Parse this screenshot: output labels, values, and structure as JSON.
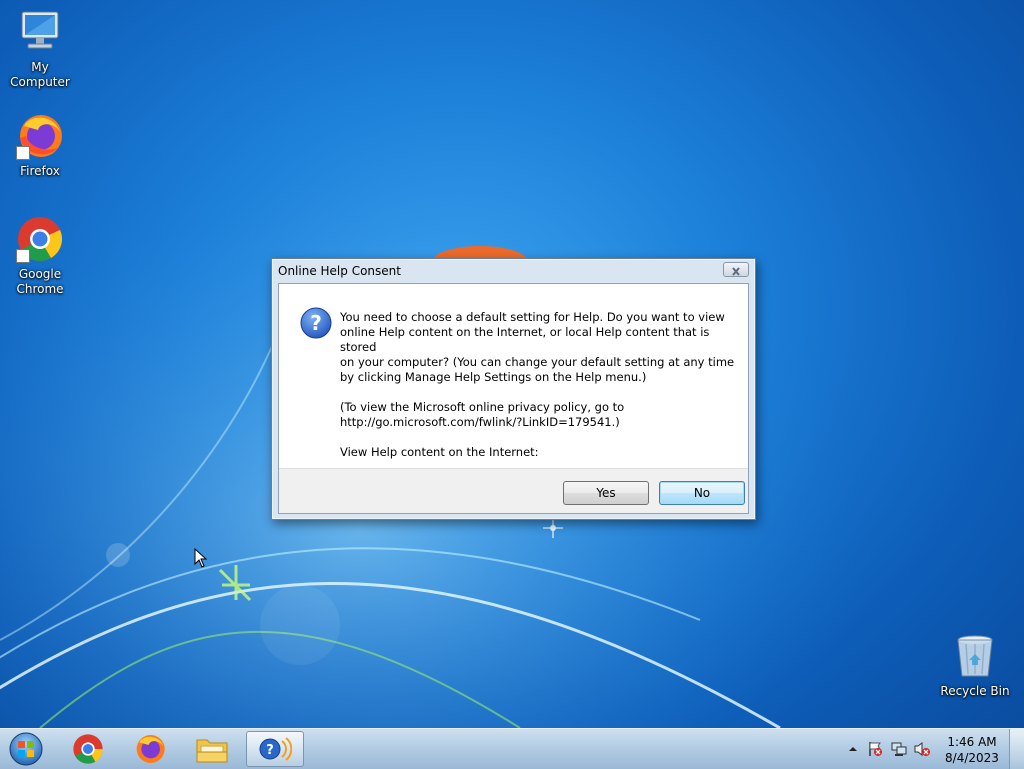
{
  "desktop": {
    "icons": [
      {
        "label": "My Computer",
        "icon": "computer-icon"
      },
      {
        "label": "Firefox",
        "icon": "firefox-icon"
      },
      {
        "label": "Google Chrome",
        "icon": "chrome-icon"
      },
      {
        "label": "Recycle Bin",
        "icon": "recycle-bin-icon"
      }
    ]
  },
  "dialog": {
    "title": "Online Help Consent",
    "icon": "question-icon",
    "paragraphs": [
      "You need to choose a default setting for Help.  Do you want to view\nonline Help content on the Internet, or local Help content that is stored\non your computer?  (You can change your default setting at any time\nby clicking Manage Help Settings on the Help menu.)",
      "(To view the Microsoft online privacy policy, go to\nhttp://go.microsoft.com/fwlink/?LinkID=179541.)",
      "View Help content on the Internet:"
    ],
    "yes_label": "Yes",
    "no_label": "No"
  },
  "taskbar": {
    "start": "start-orb-icon",
    "pinned": [
      "chrome-icon",
      "firefox-icon",
      "file-explorer-icon",
      "help-icon"
    ],
    "tray": [
      "show-hidden-icons",
      "action-center-icon",
      "network-icon",
      "volume-muted-icon"
    ],
    "clock": {
      "time": "1:46 AM",
      "date": "8/4/2023"
    }
  },
  "colors": {
    "accent": "#1c7fd8",
    "taskbar": "#b3cde4"
  }
}
